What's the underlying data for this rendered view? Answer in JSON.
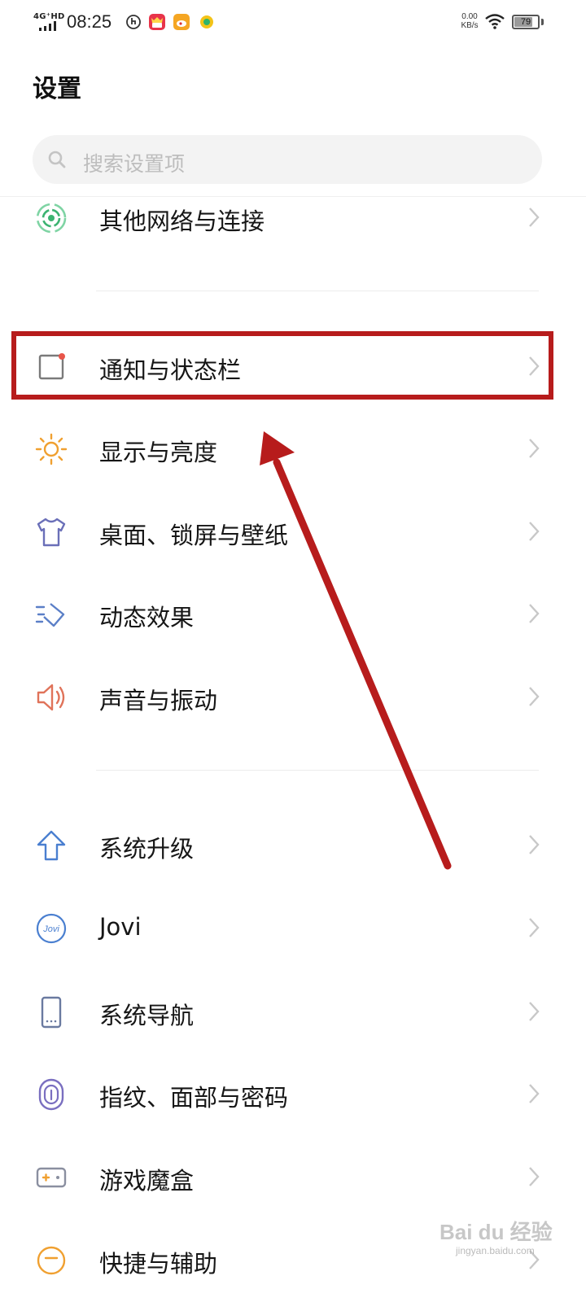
{
  "status_bar": {
    "network": "4G⁺HD",
    "time": "08:25",
    "net_speed_value": "0.00",
    "net_speed_unit": "KB/s",
    "battery": "79",
    "battery_level": 0.79
  },
  "page_title": "设置",
  "search": {
    "placeholder": "搜索设置项"
  },
  "settings": [
    {
      "label": "其他网络与连接",
      "icon": "network-connection-icon",
      "color": "#3cb371"
    },
    {
      "label": "通知与状态栏",
      "icon": "notification-icon",
      "color": "#7a7a7a",
      "highlighted": true
    },
    {
      "label": "显示与亮度",
      "icon": "sun-icon",
      "color": "#f0a030"
    },
    {
      "label": "桌面、锁屏与壁纸",
      "icon": "tshirt-icon",
      "color": "#6a6fb8"
    },
    {
      "label": "动态效果",
      "icon": "motion-effect-icon",
      "color": "#5b7fc7"
    },
    {
      "label": "声音与振动",
      "icon": "speaker-icon",
      "color": "#e0735a"
    },
    {
      "label": "系统升级",
      "icon": "upgrade-arrow-icon",
      "color": "#4a7fd0"
    },
    {
      "label": "Jovi",
      "icon": "jovi-icon",
      "color": "#4a7fd0"
    },
    {
      "label": "系统导航",
      "icon": "phone-navigation-icon",
      "color": "#6a7aa0"
    },
    {
      "label": "指纹、面部与密码",
      "icon": "fingerprint-icon",
      "color": "#7a6fc0"
    },
    {
      "label": "游戏魔盒",
      "icon": "gamepad-icon",
      "color": "#8a8fa0"
    },
    {
      "label": "快捷与辅助",
      "icon": "shortcut-icon",
      "color": "#f0a030"
    }
  ],
  "annotation": {
    "highlight_color": "#b71c1c"
  },
  "watermark": {
    "text": "Bai du 经验",
    "sub": "jingyan.baidu.com"
  }
}
